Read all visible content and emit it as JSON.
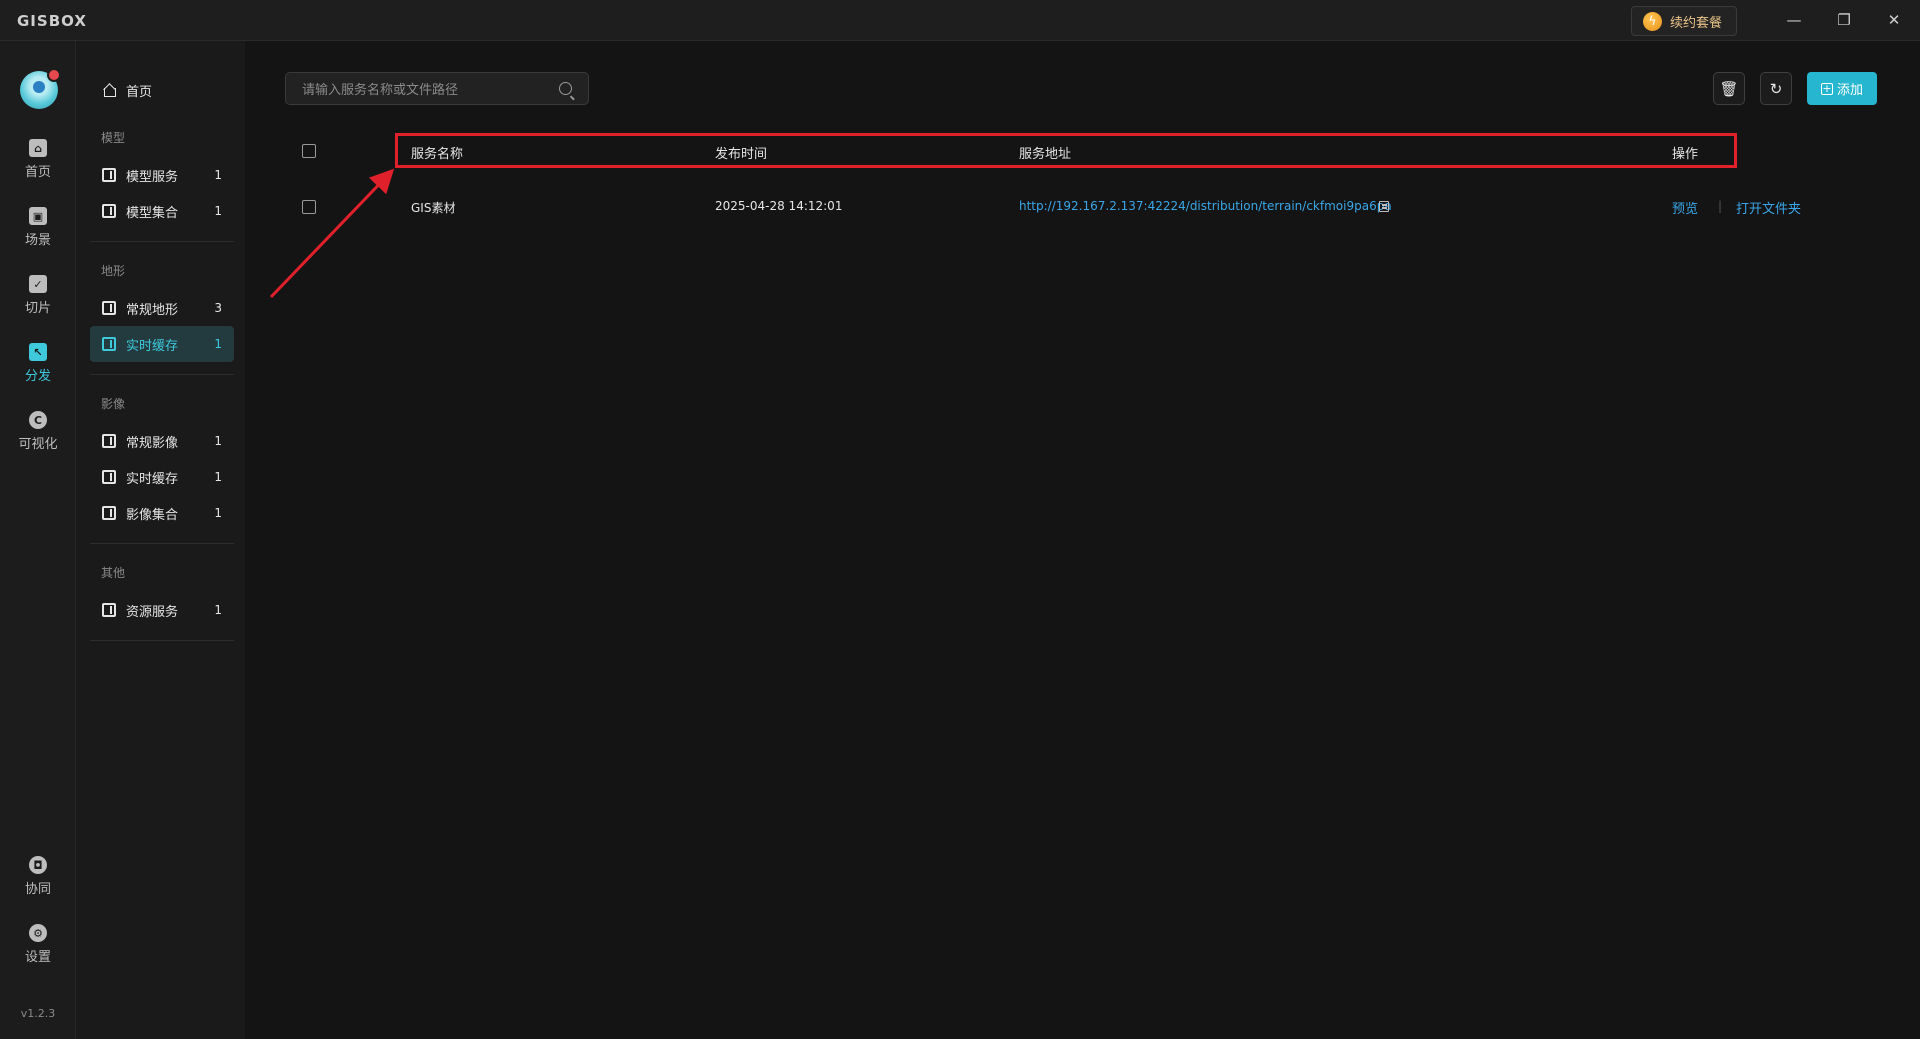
{
  "app": {
    "logo": "GISBOX",
    "renew_label": "续约套餐",
    "version": "v1.2.3"
  },
  "window_controls": {
    "minimize": "—",
    "restore": "❐",
    "close": "✕"
  },
  "rail": {
    "items": [
      {
        "label": "首页",
        "icon": "home-icon"
      },
      {
        "label": "场景",
        "icon": "scene-icon"
      },
      {
        "label": "切片",
        "icon": "slice-icon"
      },
      {
        "label": "分发",
        "icon": "distribute-icon",
        "active": true
      },
      {
        "label": "可视化",
        "icon": "visualize-icon"
      }
    ],
    "bottom_items": [
      {
        "label": "协同",
        "icon": "lock-icon"
      },
      {
        "label": "设置",
        "icon": "gear-icon"
      }
    ]
  },
  "sidebar": {
    "home_label": "首页",
    "sections": [
      {
        "title": "模型",
        "items": [
          {
            "label": "模型服务",
            "count": "1"
          },
          {
            "label": "模型集合",
            "count": "1"
          }
        ]
      },
      {
        "title": "地形",
        "items": [
          {
            "label": "常规地形",
            "count": "3"
          },
          {
            "label": "实时缓存",
            "count": "1",
            "active": true
          }
        ]
      },
      {
        "title": "影像",
        "items": [
          {
            "label": "常规影像",
            "count": "1"
          },
          {
            "label": "实时缓存",
            "count": "1"
          },
          {
            "label": "影像集合",
            "count": "1"
          }
        ]
      },
      {
        "title": "其他",
        "items": [
          {
            "label": "资源服务",
            "count": "1"
          }
        ]
      }
    ]
  },
  "toolbar": {
    "search_placeholder": "请输入服务名称或文件路径",
    "add_label": "添加"
  },
  "table": {
    "headers": [
      "服务名称",
      "发布时间",
      "服务地址",
      "操作"
    ],
    "rows": [
      {
        "name": "GIS素材",
        "time": "2025-04-28 14:12:01",
        "url": "http://192.167.2.137:42224/distribution/terrain/ckfmoi9pa6pa",
        "actions": [
          "预览",
          "打开文件夹"
        ]
      }
    ]
  },
  "colors": {
    "accent": "#3ec9dc",
    "link": "#3aa6e8",
    "annotation": "#e0202a"
  }
}
